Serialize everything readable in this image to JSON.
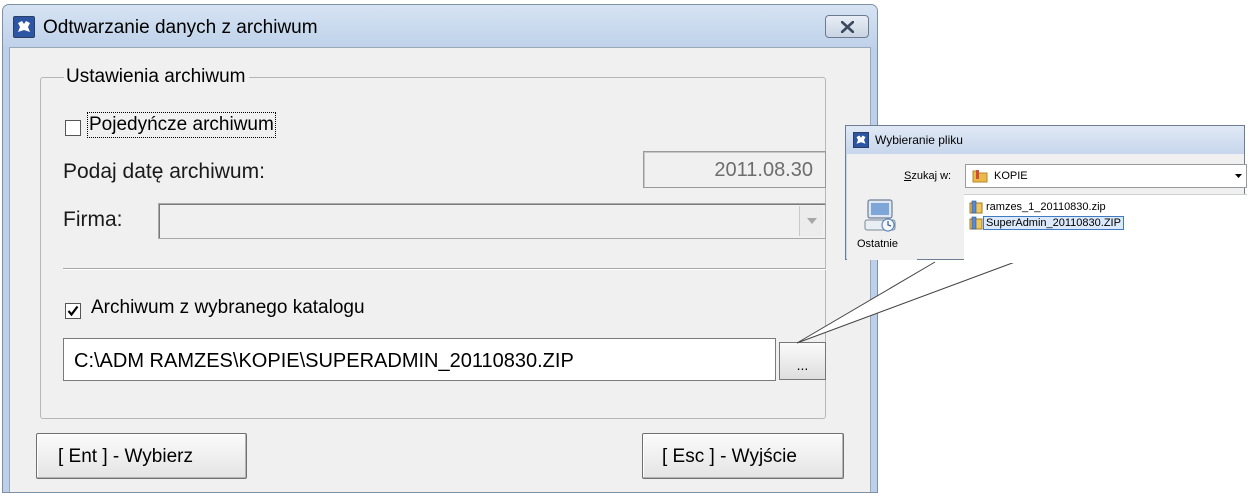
{
  "dialog": {
    "title": "Odtwarzanie danych z archiwum",
    "group_title": "Ustawienia archiwum",
    "single_archive": {
      "label": "Pojedyńcze archiwum",
      "checked": false
    },
    "date": {
      "label": "Podaj datę archiwum:",
      "value": "2011.08.30"
    },
    "company": {
      "label": "Firma:",
      "value": ""
    },
    "from_folder": {
      "label": "Archiwum z wybranego katalogu",
      "checked": true
    },
    "path": {
      "value": "C:\\ADM RAMZES\\KOPIE\\SUPERADMIN_20110830.ZIP"
    },
    "browse_label": "...",
    "ok_button": "[ Ent ] - Wybierz",
    "exit_button": "[ Esc ] - Wyjście"
  },
  "file_picker": {
    "title": "Wybieranie pliku",
    "look_in_prefix": "S",
    "look_in_rest": "zukaj w:",
    "folder": "KOPIE",
    "places": [
      {
        "label": "Ostatnie",
        "icon": "recent-places-icon"
      }
    ],
    "files": [
      {
        "name": "ramzes_1_20110830.zip",
        "selected": false
      },
      {
        "name": "SuperAdmin_20110830.ZIP",
        "selected": true
      }
    ]
  },
  "colors": {
    "title_bar": "#bfd2ea",
    "dialog_face": "#f0f0f0",
    "selection": "#3f7ac3"
  }
}
